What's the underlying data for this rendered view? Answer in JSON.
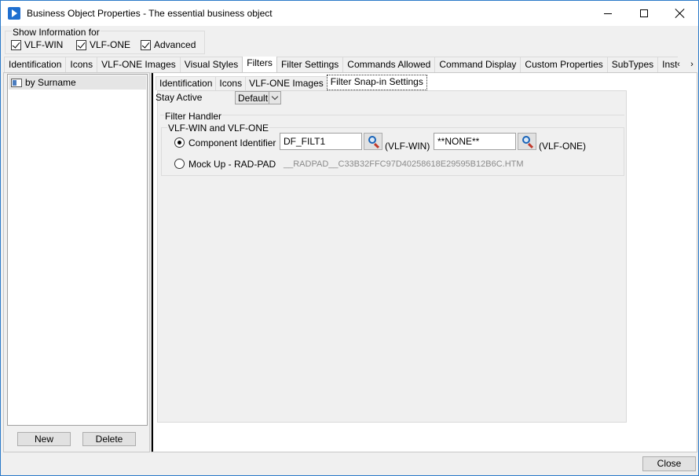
{
  "window": {
    "title": "Business Object Properties - The essential business object"
  },
  "show_info": {
    "legend": "Show Information for",
    "checkboxes": [
      {
        "label": "VLF-WIN",
        "checked": true
      },
      {
        "label": "VLF-ONE",
        "checked": true
      },
      {
        "label": "Advanced",
        "checked": true
      }
    ]
  },
  "top_tabs": [
    "Identification",
    "Icons",
    "VLF-ONE Images",
    "Visual Styles",
    "Filters",
    "Filter Settings",
    "Commands Allowed",
    "Command Display",
    "Custom Properties",
    "SubTypes",
    "Instance List / Re"
  ],
  "active_top_tab": "Filters",
  "left_panel": {
    "filters": [
      "by Surname"
    ],
    "new_label": "New",
    "delete_label": "Delete"
  },
  "sub_tabs": [
    "Identification",
    "Icons",
    "VLF-ONE Images",
    "Filter Snap-in Settings"
  ],
  "active_sub_tab": "Filter Snap-in Settings",
  "settings": {
    "stay_active_label": "Stay Active",
    "stay_active_value": "Default",
    "filter_handler_legend": "Filter Handler",
    "vlf_group_legend": "VLF-WIN and VLF-ONE",
    "component_identifier_label": "Component Identifier",
    "component_identifier_selected": true,
    "vlf_win_value": "DF_FILT1",
    "vlf_win_tag": "(VLF-WIN)",
    "vlf_one_value": "**NONE**",
    "vlf_one_tag": "(VLF-ONE)",
    "mockup_label": "Mock Up - RAD-PAD",
    "mockup_selected": false,
    "mockup_file": "__RADPAD__C33B32FFC97D40258618E29595B12B6C.HTM"
  },
  "footer": {
    "close_label": "Close"
  }
}
